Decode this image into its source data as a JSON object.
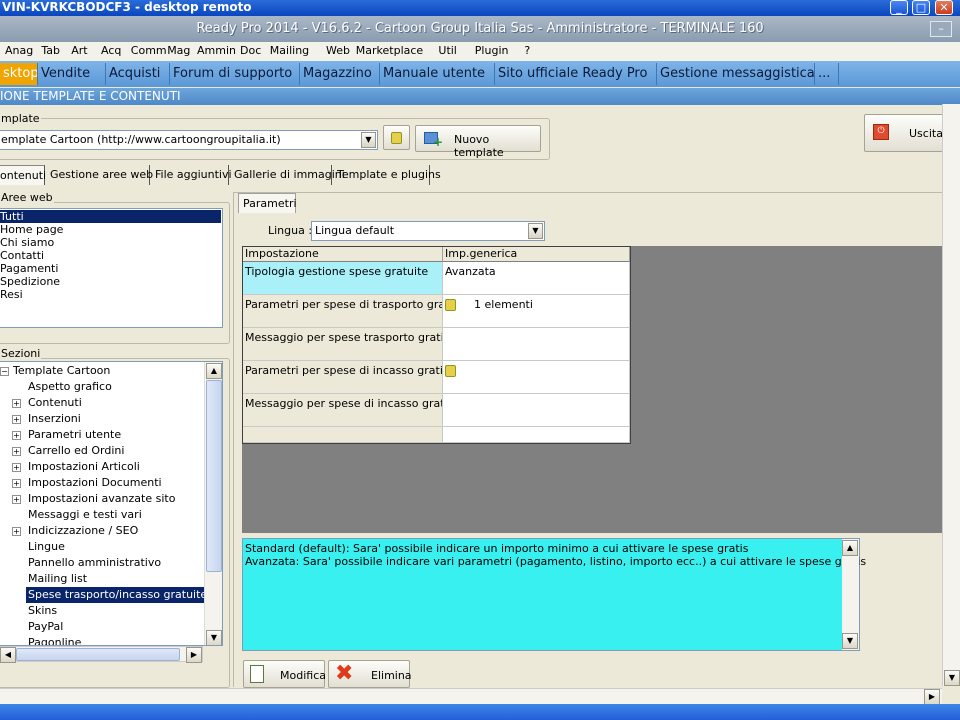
{
  "outer_window": {
    "title": "VIN-KVRKCBODCF3 - desktop remoto"
  },
  "app": {
    "title": "Ready Pro 2014 - V16.6.2 - Cartoon Group Italia Sas - Amministratore - TERMINALE 160"
  },
  "menu": [
    "Anag",
    "Tab",
    "Art",
    "Acq",
    "Comm",
    "Mag",
    "Ammin",
    "Doc",
    "Mailing",
    "Web",
    "Marketplace",
    "Util",
    "Plugin",
    "?"
  ],
  "app_tabs": [
    {
      "label": "sktop",
      "active": true
    },
    {
      "label": "Vendite"
    },
    {
      "label": "Acquisti"
    },
    {
      "label": "Forum di supporto"
    },
    {
      "label": "Magazzino"
    },
    {
      "label": "Manuale utente"
    },
    {
      "label": "Sito ufficiale Ready Pro"
    },
    {
      "label": "Gestione messaggistica"
    },
    {
      "label": "..."
    }
  ],
  "section_header": "IONE TEMPLATE E CONTENUTI",
  "template": {
    "group_label": "mplate",
    "selected": "emplate Cartoon (http://www.cartoongroupitalia.it)",
    "new_button": "Nuovo template"
  },
  "exit_button": "Uscita",
  "sub_tabs": [
    "ontenuti",
    "Gestione aree web",
    "File aggiuntivi",
    "Gallerie di immagini",
    "Template e plugins"
  ],
  "aree_web": {
    "label": "Aree web",
    "items": [
      {
        "label": "Tutti",
        "selected": true
      },
      {
        "label": "Home page"
      },
      {
        "label": "Chi siamo"
      },
      {
        "label": "Contatti"
      },
      {
        "label": "Pagamenti"
      },
      {
        "label": "Spedizione"
      },
      {
        "label": "Resi"
      }
    ]
  },
  "sezioni": {
    "label": "Sezioni",
    "root": "Template Cartoon",
    "items": [
      {
        "label": "Aspetto grafico",
        "expandable": false
      },
      {
        "label": "Contenuti",
        "expandable": true
      },
      {
        "label": "Inserzioni",
        "expandable": true
      },
      {
        "label": "Parametri utente",
        "expandable": true
      },
      {
        "label": "Carrello ed Ordini",
        "expandable": true
      },
      {
        "label": "Impostazioni Articoli",
        "expandable": true
      },
      {
        "label": "Impostazioni Documenti",
        "expandable": true
      },
      {
        "label": "Impostazioni avanzate sito",
        "expandable": true
      },
      {
        "label": "Messaggi e testi vari",
        "expandable": false
      },
      {
        "label": "Indicizzazione / SEO",
        "expandable": true
      },
      {
        "label": "Lingue",
        "expandable": false
      },
      {
        "label": "Pannello amministrativo",
        "expandable": false
      },
      {
        "label": "Mailing list",
        "expandable": false
      },
      {
        "label": "Spese trasporto/incasso gratuite",
        "expandable": false,
        "selected": true
      },
      {
        "label": "Skins",
        "expandable": false
      },
      {
        "label": "PayPal",
        "expandable": false
      },
      {
        "label": "Pagonline",
        "expandable": false
      }
    ]
  },
  "parametri": {
    "tab": "Parametri",
    "lingua_label": "Lingua :",
    "lingua_value": "Lingua default",
    "columns": [
      "Impostazione",
      "Imp.generica"
    ],
    "rows": [
      {
        "setting": "Tipologia gestione spese gratuite",
        "value": "Avanzata",
        "icon": false,
        "highlight": true
      },
      {
        "setting": "Parametri per spese di trasporto gratis",
        "value": "1 elementi",
        "icon": true
      },
      {
        "setting": "Messaggio per spese trasporto gratis",
        "value": "",
        "icon": false
      },
      {
        "setting": "Parametri per spese di incasso gratis",
        "value": "",
        "icon": true
      },
      {
        "setting": "Messaggio per spese di incasso gratis",
        "value": "",
        "icon": false
      },
      {
        "setting": "",
        "value": "",
        "icon": false
      }
    ]
  },
  "description": {
    "line1": "Standard (default): Sara' possibile indicare un importo minimo a cui attivare le spese gratis",
    "line2": "Avanzata: Sara' possibile indicare vari parametri (pagamento, listino, importo ecc..) a cui attivare le spese gratis"
  },
  "actions": {
    "modify": "Modifica",
    "delete": "Elimina"
  },
  "colors": {
    "accent_tab": "#f0a400",
    "selection": "#0a246a",
    "description_bg": "#38f0f0",
    "highlight_cell": "#aaf0f8"
  }
}
